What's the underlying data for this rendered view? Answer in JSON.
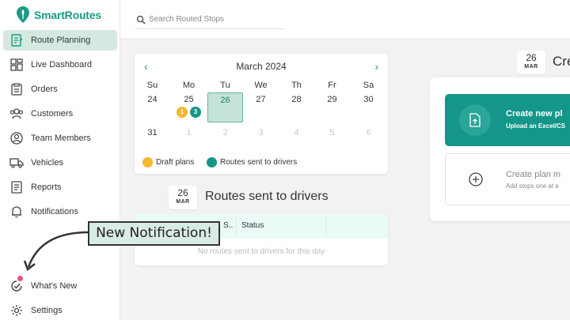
{
  "app": {
    "name": "SmartRoutes",
    "brand_color": "#1a9b84"
  },
  "search": {
    "placeholder": "Search Routed Stops"
  },
  "sidebar": {
    "items": [
      {
        "label": "Route Planning",
        "icon": "route-planning-icon",
        "active": true
      },
      {
        "label": "Live Dashboard",
        "icon": "dashboard-icon"
      },
      {
        "label": "Orders",
        "icon": "orders-icon"
      },
      {
        "label": "Customers",
        "icon": "customers-icon"
      },
      {
        "label": "Team Members",
        "icon": "team-icon"
      },
      {
        "label": "Vehicles",
        "icon": "truck-icon"
      },
      {
        "label": "Reports",
        "icon": "reports-icon"
      },
      {
        "label": "Notifications",
        "icon": "bell-icon"
      },
      {
        "label": "What's New",
        "icon": "whats-new-icon"
      },
      {
        "label": "Settings",
        "icon": "gear-icon"
      }
    ]
  },
  "calendar": {
    "month_label": "March 2024",
    "weekdays": [
      "Su",
      "Mo",
      "Tu",
      "We",
      "Th",
      "Fr",
      "Sa"
    ],
    "week1": [
      "24",
      "25",
      "26",
      "27",
      "28",
      "29",
      "30"
    ],
    "week2": [
      "31",
      "1",
      "2",
      "3",
      "4",
      "5",
      "6"
    ],
    "selected": "26",
    "draft_count": "1",
    "sent_count": "3",
    "legend": {
      "draft": "Draft plans",
      "sent": "Routes sent to drivers"
    },
    "colors": {
      "draft": "#f5b82e",
      "sent": "#14968a"
    }
  },
  "routes_section": {
    "date_day": "26",
    "date_month": "MAR",
    "title": "Routes sent to drivers",
    "columns": [
      "S..",
      "Status"
    ],
    "empty_text": "No routes sent to drivers for this day"
  },
  "plan_section": {
    "date_day": "26",
    "date_month": "MAR",
    "title": "Cre",
    "create_new": {
      "title": "Create new pl",
      "subtitle": "Upload an Excel/CS"
    },
    "create_manual": {
      "title": "Create plan m",
      "subtitle": "Add stops one at a"
    }
  },
  "annotation": {
    "text": "New Notification!"
  }
}
